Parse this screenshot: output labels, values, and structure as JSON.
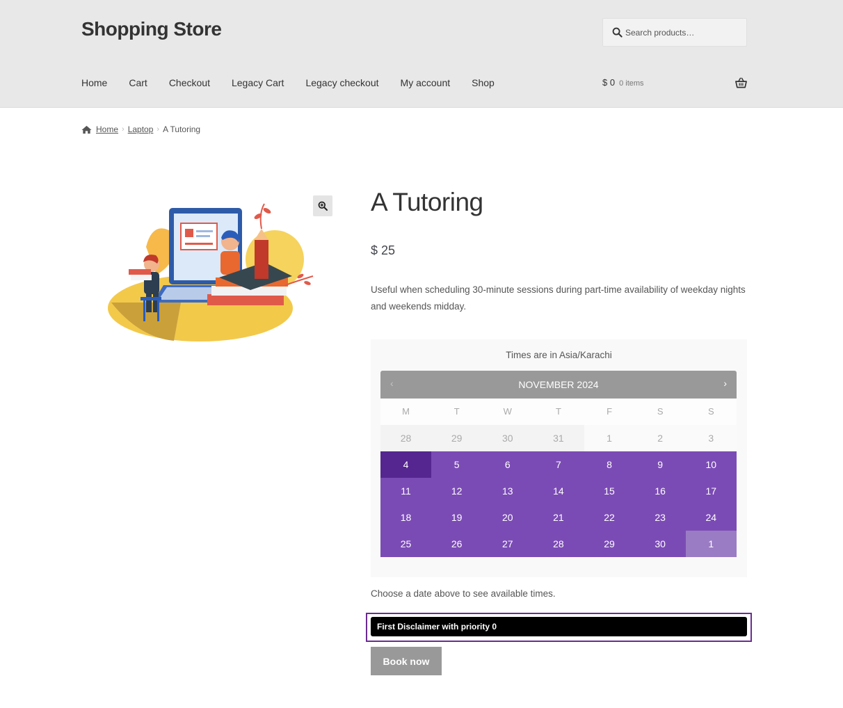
{
  "header": {
    "site_title": "Shopping Store",
    "search": {
      "placeholder": "Search products…",
      "icon": "search-icon"
    },
    "nav": [
      "Home",
      "Cart",
      "Checkout",
      "Legacy Cart",
      "Legacy checkout",
      "My account",
      "Shop"
    ],
    "cart": {
      "amount": "$ 0",
      "count": "0 items",
      "icon": "basket-icon"
    }
  },
  "breadcrumb": {
    "icon": "home-icon",
    "items": [
      "Home",
      "Laptop"
    ],
    "current": "A Tutoring"
  },
  "product": {
    "title": "A Tutoring",
    "price": "$ 25",
    "description": "Useful when scheduling 30-minute sessions during part-time availability of weekday nights and weekends midday.",
    "zoom_icon": "zoom-in-icon"
  },
  "booking": {
    "timezone_note": "Times are in Asia/Karachi",
    "calendar": {
      "month": "NOVEMBER 2024",
      "prev": "‹",
      "next": "›",
      "weekdays": [
        "M",
        "T",
        "W",
        "T",
        "F",
        "S",
        "S"
      ],
      "weeks": [
        [
          "28",
          "29",
          "30",
          "31",
          "1",
          "2",
          "3"
        ],
        [
          "4",
          "5",
          "6",
          "7",
          "8",
          "9",
          "10"
        ],
        [
          "11",
          "12",
          "13",
          "14",
          "15",
          "16",
          "17"
        ],
        [
          "18",
          "19",
          "20",
          "21",
          "22",
          "23",
          "24"
        ],
        [
          "25",
          "26",
          "27",
          "28",
          "29",
          "30",
          "1"
        ]
      ],
      "colors": {
        "available": "#7b4bb5",
        "selected": "#552690",
        "header": "#999999"
      }
    },
    "hint": "Choose a date above to see available times.",
    "disclaimer": "First Disclaimer with priority 0",
    "book_button": "Book now"
  }
}
